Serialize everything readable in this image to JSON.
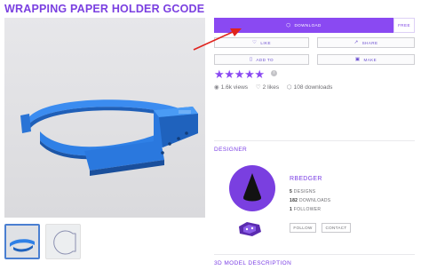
{
  "page": {
    "title": "WRAPPING PAPER HOLDER GCODE"
  },
  "actions": {
    "download_label": "DOWNLOAD",
    "free_label": "FREE",
    "like_label": "LIKE",
    "share_label": "SHARE",
    "add_to_label": "ADD TO",
    "make_label": "MAKE"
  },
  "rating": {
    "stars": "★★★★★",
    "value": 5,
    "max": 5,
    "info": "i"
  },
  "stats": {
    "views": "1.6k views",
    "likes": "2 likes",
    "downloads": "108 downloads"
  },
  "designer": {
    "section_label": "DESIGNER",
    "name": "RBEDGER",
    "designs_count": "5",
    "designs_label": "DESIGNS",
    "downloads_count": "182",
    "downloads_label": "DOWNLOADS",
    "followers_count": "1",
    "followers_label": "FOLLOWER",
    "follow_label": "FOLLOW",
    "contact_label": "CONTACT"
  },
  "description": {
    "section_label": "3D MODEL DESCRIPTION"
  },
  "colors": {
    "accent": "#8a49f2",
    "title": "#7a3fe0",
    "model": "#2f7ee0",
    "arrow": "#e0231d"
  }
}
